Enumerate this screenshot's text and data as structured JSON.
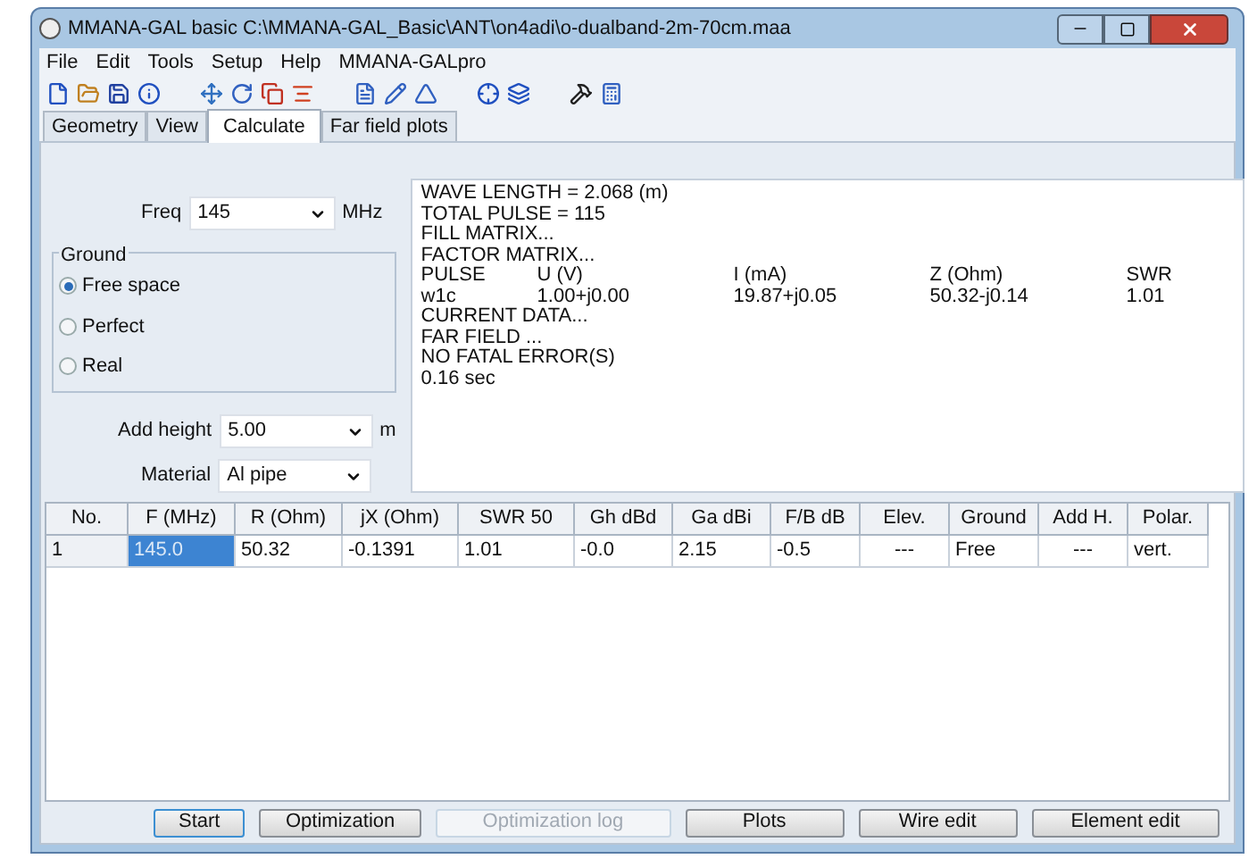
{
  "window": {
    "title": "MMANA-GAL basic C:\\MMANA-GAL_Basic\\ANT\\on4adi\\o-dualband-2m-70cm.maa"
  },
  "menu": [
    "File",
    "Edit",
    "Tools",
    "Setup",
    "Help",
    "MMANA-GALpro"
  ],
  "tabs": [
    {
      "label": "Geometry",
      "selected": false
    },
    {
      "label": "View",
      "selected": false
    },
    {
      "label": "Calculate",
      "selected": true
    },
    {
      "label": "Far field plots",
      "selected": false
    }
  ],
  "freq": {
    "label": "Freq",
    "value": "145",
    "unit": "MHz"
  },
  "ground": {
    "title": "Ground",
    "options": [
      {
        "label": "Free space",
        "selected": true
      },
      {
        "label": "Perfect",
        "selected": false
      },
      {
        "label": "Real",
        "selected": false
      }
    ]
  },
  "add_height": {
    "label": "Add height",
    "value": "5.00",
    "unit": "m"
  },
  "material": {
    "label": "Material",
    "value": "Al pipe"
  },
  "log": [
    {
      "cells": [
        "WAVE LENGTH = 2.068 (m)"
      ]
    },
    {
      "cells": [
        "TOTAL PULSE = 115"
      ]
    },
    {
      "cells": [
        "FILL MATRIX..."
      ]
    },
    {
      "cells": [
        "FACTOR MATRIX..."
      ]
    },
    {
      "cells": [
        "PULSE",
        "U (V)",
        "I (mA)",
        "Z (Ohm)",
        "SWR"
      ]
    },
    {
      "cells": [
        "w1c",
        "1.00+j0.00",
        "19.87+j0.05",
        "50.32-j0.14",
        "1.01"
      ]
    },
    {
      "cells": [
        "CURRENT DATA..."
      ]
    },
    {
      "cells": [
        "FAR FIELD ..."
      ]
    },
    {
      "cells": [
        "NO FATAL ERROR(S)"
      ]
    },
    {
      "cells": [
        "0.16 sec"
      ]
    }
  ],
  "table": {
    "columns": [
      "No.",
      "F (MHz)",
      "R (Ohm)",
      "jX (Ohm)",
      "SWR 50",
      "Gh dBd",
      "Ga dBi",
      "F/B dB",
      "Elev.",
      "Ground",
      "Add H.",
      "Polar."
    ],
    "rows": [
      {
        "cells": [
          {
            "text": "1",
            "selected": false
          },
          {
            "text": "145.0",
            "selected": true
          },
          {
            "text": "50.32",
            "selected": false
          },
          {
            "text": "-0.1391",
            "selected": false
          },
          {
            "text": "1.01",
            "selected": false
          },
          {
            "text": "-0.0",
            "selected": false
          },
          {
            "text": "2.15",
            "selected": false
          },
          {
            "text": "-0.5",
            "selected": false
          },
          {
            "text": "---",
            "selected": false
          },
          {
            "text": "Free",
            "selected": false
          },
          {
            "text": "---",
            "selected": false
          },
          {
            "text": "vert.",
            "selected": false
          }
        ]
      }
    ]
  },
  "buttons": [
    {
      "label": "Start",
      "disabled": false,
      "focused": true
    },
    {
      "label": "Optimization",
      "disabled": false,
      "focused": false
    },
    {
      "label": "Optimization log",
      "disabled": true,
      "focused": false
    },
    {
      "label": "Plots",
      "disabled": false,
      "focused": false
    },
    {
      "label": "Wire edit",
      "disabled": false,
      "focused": false
    },
    {
      "label": "Element edit",
      "disabled": false,
      "focused": false
    }
  ]
}
